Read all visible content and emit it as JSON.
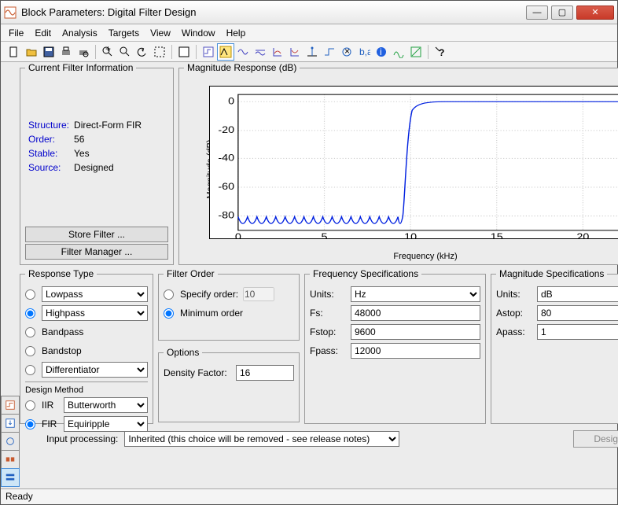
{
  "window": {
    "title": "Block Parameters: Digital Filter Design"
  },
  "menu": {
    "file": "File",
    "edit": "Edit",
    "analysis": "Analysis",
    "targets": "Targets",
    "view": "View",
    "window": "Window",
    "help": "Help"
  },
  "filter_info": {
    "legend": "Current Filter Information",
    "structure_label": "Structure:",
    "structure": "Direct-Form FIR",
    "order_label": "Order:",
    "order": "56",
    "stable_label": "Stable:",
    "stable": "Yes",
    "source_label": "Source:",
    "source": "Designed",
    "store_btn": "Store Filter ...",
    "manager_btn": "Filter Manager ..."
  },
  "magresp": {
    "legend": "Magnitude Response (dB)",
    "ylabel": "Magnitude (dB)",
    "xlabel": "Frequency (kHz)"
  },
  "response_type": {
    "legend": "Response Type",
    "lowpass": "Lowpass",
    "highpass": "Highpass",
    "bandpass": "Bandpass",
    "bandstop": "Bandstop",
    "differentiator": "Differentiator"
  },
  "design_method": {
    "legend": "Design Method",
    "iir": "IIR",
    "iir_val": "Butterworth",
    "fir": "FIR",
    "fir_val": "Equiripple"
  },
  "filter_order": {
    "legend": "Filter Order",
    "specify": "Specify order:",
    "specify_val": "10",
    "minimum": "Minimum order"
  },
  "options": {
    "legend": "Options",
    "dfactor_label": "Density Factor:",
    "dfactor": "16"
  },
  "freq_spec": {
    "legend": "Frequency Specifications",
    "units_label": "Units:",
    "units": "Hz",
    "fs_label": "Fs:",
    "fs": "48000",
    "fstop_label": "Fstop:",
    "fstop": "9600",
    "fpass_label": "Fpass:",
    "fpass": "12000"
  },
  "mag_spec": {
    "legend": "Magnitude Specifications",
    "units_label": "Units:",
    "units": "dB",
    "astop_label": "Astop:",
    "astop": "80",
    "apass_label": "Apass:",
    "apass": "1"
  },
  "input_proc": {
    "label": "Input processing:",
    "value": "Inherited (this choice will be removed - see release notes)"
  },
  "design_filter_btn": "Design Filter",
  "status": "Ready",
  "chart_data": {
    "type": "line",
    "title": "Magnitude Response (dB)",
    "xlabel": "Frequency (kHz)",
    "ylabel": "Magnitude (dB)",
    "xlim": [
      0,
      24
    ],
    "ylim": [
      -90,
      5
    ],
    "xticks": [
      0,
      5,
      10,
      15,
      20
    ],
    "yticks": [
      -80,
      -60,
      -40,
      -20,
      0
    ],
    "series": [
      {
        "name": "Magnitude",
        "description": "Highpass FIR equiripple filter response",
        "stopband": {
          "x_range": [
            0,
            9.6
          ],
          "mag_dB": -80,
          "ripple_lobes": 17,
          "lobe_peak_dB": -80,
          "lobe_trough_dB": -100
        },
        "transition": {
          "x_range": [
            9.6,
            12.0
          ]
        },
        "passband": {
          "x_range": [
            12.0,
            24.0
          ],
          "mag_dB": 0,
          "ripple_dB": 1
        }
      }
    ]
  }
}
